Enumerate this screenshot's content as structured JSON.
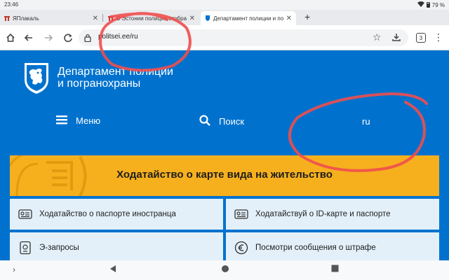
{
  "status_bar": {
    "time": "23:46",
    "battery": "79 %"
  },
  "tabs": [
    {
      "title": "ЯПлакаль",
      "close": "✕"
    },
    {
      "title": "В Эстонии полиция отобрала",
      "close": "✕"
    },
    {
      "title": "Департамент полиции и погранохраны",
      "close": "✕",
      "active": true
    }
  ],
  "toolbar": {
    "url": "politsei.ee/ru",
    "tab_count": "3"
  },
  "site": {
    "brand_line1": "Департамент полиции",
    "brand_line2": "и погранохраны",
    "nav": {
      "menu": "Меню",
      "search": "Поиск",
      "lang": "ru"
    },
    "banner": "Ходатайство о карте вида на жительство",
    "cards": [
      {
        "label": "Ходатайство о паспорте иностранца",
        "icon": "passport-card-icon"
      },
      {
        "label": "Ходатайствуй о ID-карте и паспорте",
        "icon": "id-card-icon"
      },
      {
        "label": "Э-запросы",
        "icon": "document-stamp-icon"
      },
      {
        "label": "Посмотри сообщения о штрафе",
        "icon": "euro-coin-icon"
      }
    ]
  },
  "colors": {
    "page_blue": "#0072ce",
    "banner_yellow": "#f6b01e",
    "card_bg": "#e3f0fa",
    "annotation_red": "#f04e4e"
  }
}
